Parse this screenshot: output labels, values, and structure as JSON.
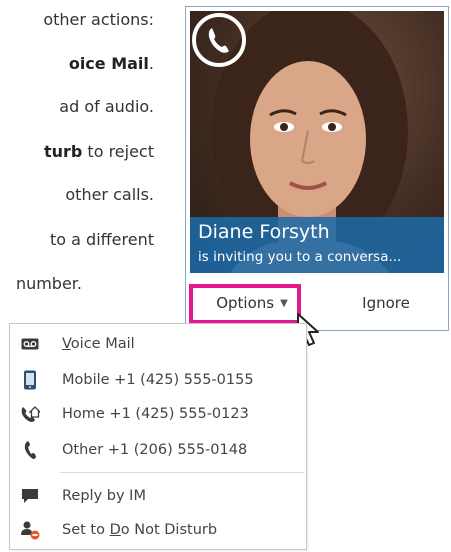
{
  "instructions": {
    "line1": "other actions:",
    "line2_bold": "oice Mail",
    "line2_rest": ".",
    "line3": "ad of audio.",
    "line4_bold": "turb",
    "line4_rest": " to reject",
    "line5": "other calls.",
    "line6": "to a different",
    "line7": "number."
  },
  "notification": {
    "caller_name": "Diane Forsyth",
    "subtitle": "is inviting you to a conversa...",
    "options_label": "Options",
    "ignore_label": "Ignore"
  },
  "menu": {
    "voice_mail_prefix": "",
    "voice_mail_u": "V",
    "voice_mail_rest": "oice Mail",
    "mobile": "Mobile +1 (425) 555-0155",
    "home": "Home +1 (425) 555-0123",
    "other": "Other +1 (206) 555-0148",
    "reply_im": "Reply by IM",
    "dnd_prefix": "Set to ",
    "dnd_u": "D",
    "dnd_rest": "o Not Disturb"
  },
  "colors": {
    "highlight": "#e5178e",
    "caller_bar": "#1c6baa",
    "menu_icon": "#3a3a3a",
    "dnd_badge": "#e8552a"
  }
}
